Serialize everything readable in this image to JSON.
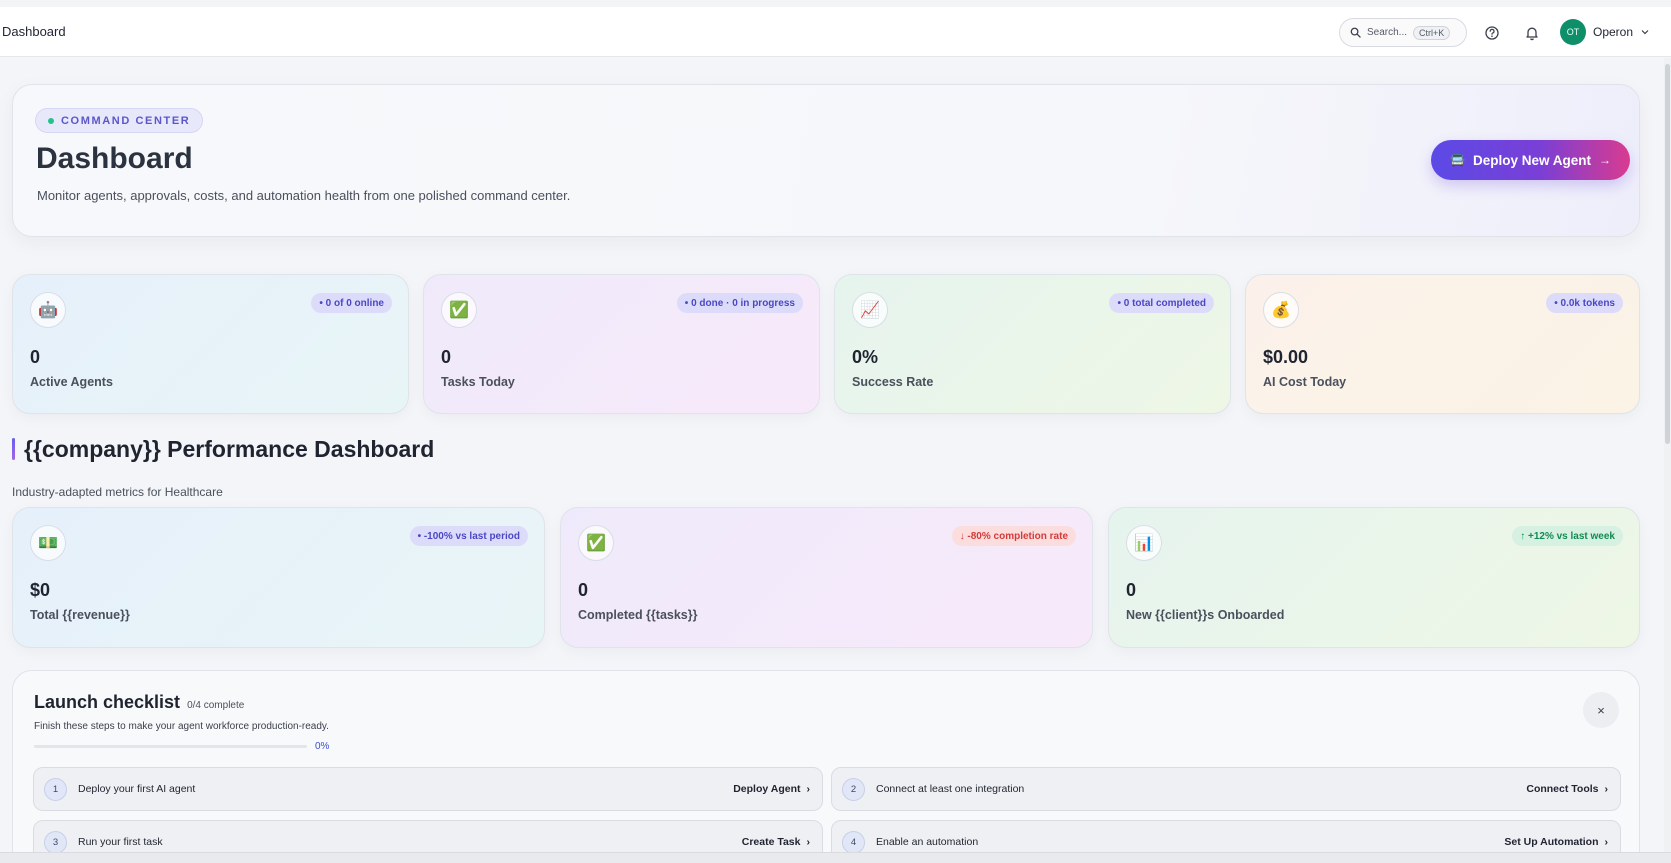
{
  "topbar": {
    "page_name": "Dashboard",
    "search_label": "Search...",
    "search_shortcut": "Ctrl+K",
    "user_initials": "OT",
    "user_name": "Operon"
  },
  "hero": {
    "chip": "COMMAND CENTER",
    "title": "Dashboard",
    "subtitle": "Monitor agents, approvals, costs, and automation health from one polished command center.",
    "deploy_label": "Deploy New Agent"
  },
  "stats": [
    {
      "value": "0",
      "label": "Active Agents",
      "badge": "• 0 of 0 online",
      "icon": "robot-icon",
      "glyph": "🤖"
    },
    {
      "value": "0",
      "label": "Tasks Today",
      "badge": "• 0 done · 0 in progress",
      "icon": "checkmark-icon",
      "glyph": "✅"
    },
    {
      "value": "0%",
      "label": "Success Rate",
      "badge": "• 0 total completed",
      "icon": "chart-up-icon",
      "glyph": "📈"
    },
    {
      "value": "$0.00",
      "label": "AI Cost Today",
      "badge": "• 0.0k tokens",
      "icon": "money-bag-icon",
      "glyph": "💰"
    }
  ],
  "performance": {
    "title": "{{company}} Performance Dashboard",
    "subtitle": "Industry-adapted metrics for Healthcare",
    "cards": [
      {
        "value": "$0",
        "label": "Total {{revenue}}",
        "badge": "• -100% vs last period",
        "icon": "cash-icon",
        "glyph": "💵"
      },
      {
        "value": "0",
        "label": "Completed {{tasks}}",
        "badge": "↓ -80% completion rate",
        "icon": "checkmark-icon",
        "glyph": "✅"
      },
      {
        "value": "0",
        "label": "New {{client}}s Onboarded",
        "badge": "↑ +12% vs last week",
        "icon": "bar-chart-icon",
        "glyph": "📊"
      }
    ]
  },
  "checklist": {
    "title": "Launch checklist",
    "count": "0/4 complete",
    "subtitle": "Finish these steps to make your agent workforce production-ready.",
    "progress_pct": "0%",
    "progress_value": 0,
    "steps": [
      {
        "num": "1",
        "text": "Deploy your first AI agent",
        "action": "Deploy Agent"
      },
      {
        "num": "2",
        "text": "Connect at least one integration",
        "action": "Connect Tools"
      },
      {
        "num": "3",
        "text": "Run your first task",
        "action": "Create Task"
      },
      {
        "num": "4",
        "text": "Enable an automation",
        "action": "Set Up Automation"
      }
    ]
  },
  "colors": {
    "accent": "#5b4ae6",
    "accent_pink": "#d93b8f",
    "avatar": "#0e8f6a"
  }
}
